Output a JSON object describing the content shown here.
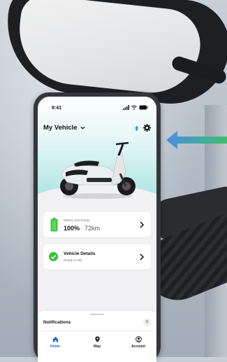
{
  "status_bar": {
    "time": "9:41"
  },
  "header": {
    "title": "My Vehicle"
  },
  "battery_card": {
    "label": "Battery and Range",
    "percent": "100%",
    "separator": "·",
    "range": "72km",
    "level": 1.0
  },
  "vehicle_card": {
    "title": "Vehicle Details",
    "subtitle": "Ready to ride"
  },
  "notifications": {
    "label": "Notifications",
    "count": "0"
  },
  "tabs": [
    {
      "label": "Home",
      "icon": "home-icon",
      "active": true
    },
    {
      "label": "Map",
      "icon": "map-pin-icon",
      "active": false
    },
    {
      "label": "Account",
      "icon": "account-icon",
      "active": false
    }
  ],
  "colors": {
    "accent": "#1e63d6",
    "battery": "#3cc43c",
    "check": "#33c23a",
    "hero_teal": "#a9e4e0"
  }
}
